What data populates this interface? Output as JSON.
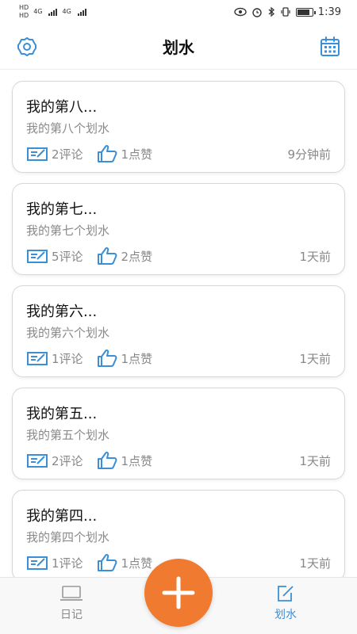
{
  "status_bar": {
    "left_top": "HD",
    "left_bottom": "HD",
    "network_1": "4G",
    "network_2": "4G",
    "time": "1:39"
  },
  "header": {
    "title": "划水",
    "left_icon": "settings-gear-icon",
    "right_icon": "calendar-icon"
  },
  "posts": [
    {
      "title": "我的第八...",
      "subtitle": "我的第八个划水",
      "comments": "2评论",
      "likes": "1点赞",
      "time": "9分钟前"
    },
    {
      "title": "我的第七...",
      "subtitle": "我的第七个划水",
      "comments": "5评论",
      "likes": "2点赞",
      "time": "1天前"
    },
    {
      "title": "我的第六...",
      "subtitle": "我的第六个划水",
      "comments": "1评论",
      "likes": "1点赞",
      "time": "1天前"
    },
    {
      "title": "我的第五...",
      "subtitle": "我的第五个划水",
      "comments": "2评论",
      "likes": "1点赞",
      "time": "1天前"
    },
    {
      "title": "我的第四...",
      "subtitle": "我的第四个划水",
      "comments": "1评论",
      "likes": "1点赞",
      "time": "1天前"
    }
  ],
  "tabs": [
    {
      "label": "日记",
      "icon": "laptop-icon",
      "active": false
    },
    {
      "label": "划水",
      "icon": "edit-icon",
      "active": true
    }
  ],
  "colors": {
    "accent": "#3a8fd6",
    "fab": "#f07a2f",
    "muted": "#888888"
  }
}
